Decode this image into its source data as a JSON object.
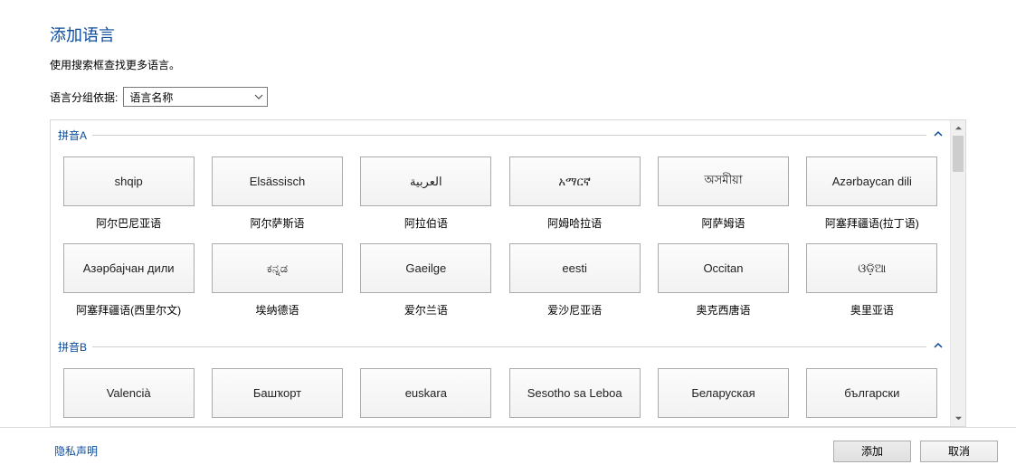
{
  "title": "添加语言",
  "subtitle": "使用搜索框查找更多语言。",
  "group_by_label": "语言分组依据:",
  "group_by_value": "语言名称",
  "groups": [
    {
      "name": "拼音A",
      "langs": [
        {
          "native": "shqip",
          "label": "阿尔巴尼亚语"
        },
        {
          "native": "Elsässisch",
          "label": "阿尔萨斯语"
        },
        {
          "native": "العربية",
          "label": "阿拉伯语"
        },
        {
          "native": "አማርኛ",
          "label": "阿姆哈拉语"
        },
        {
          "native": "অসমীয়া",
          "label": "阿萨姆语"
        },
        {
          "native": "Azərbaycan dili",
          "label": "阿塞拜疆语(拉丁语)"
        },
        {
          "native": "Азәрбајчан дили",
          "label": "阿塞拜疆语(西里尔文)"
        },
        {
          "native": "ಕನ್ನಡ",
          "label": "埃纳德语"
        },
        {
          "native": "Gaeilge",
          "label": "爱尔兰语"
        },
        {
          "native": "eesti",
          "label": "爱沙尼亚语"
        },
        {
          "native": "Occitan",
          "label": "奥克西唐语"
        },
        {
          "native": "ଓଡ଼ିଆ",
          "label": "奥里亚语"
        }
      ]
    },
    {
      "name": "拼音B",
      "langs": [
        {
          "native": "Valencià",
          "label": ""
        },
        {
          "native": "Башҡорт",
          "label": ""
        },
        {
          "native": "euskara",
          "label": ""
        },
        {
          "native": "Sesotho sa Leboa",
          "label": ""
        },
        {
          "native": "Беларуская",
          "label": ""
        },
        {
          "native": "български",
          "label": ""
        }
      ]
    }
  ],
  "footer": {
    "privacy": "隐私声明",
    "add": "添加",
    "cancel": "取消"
  }
}
